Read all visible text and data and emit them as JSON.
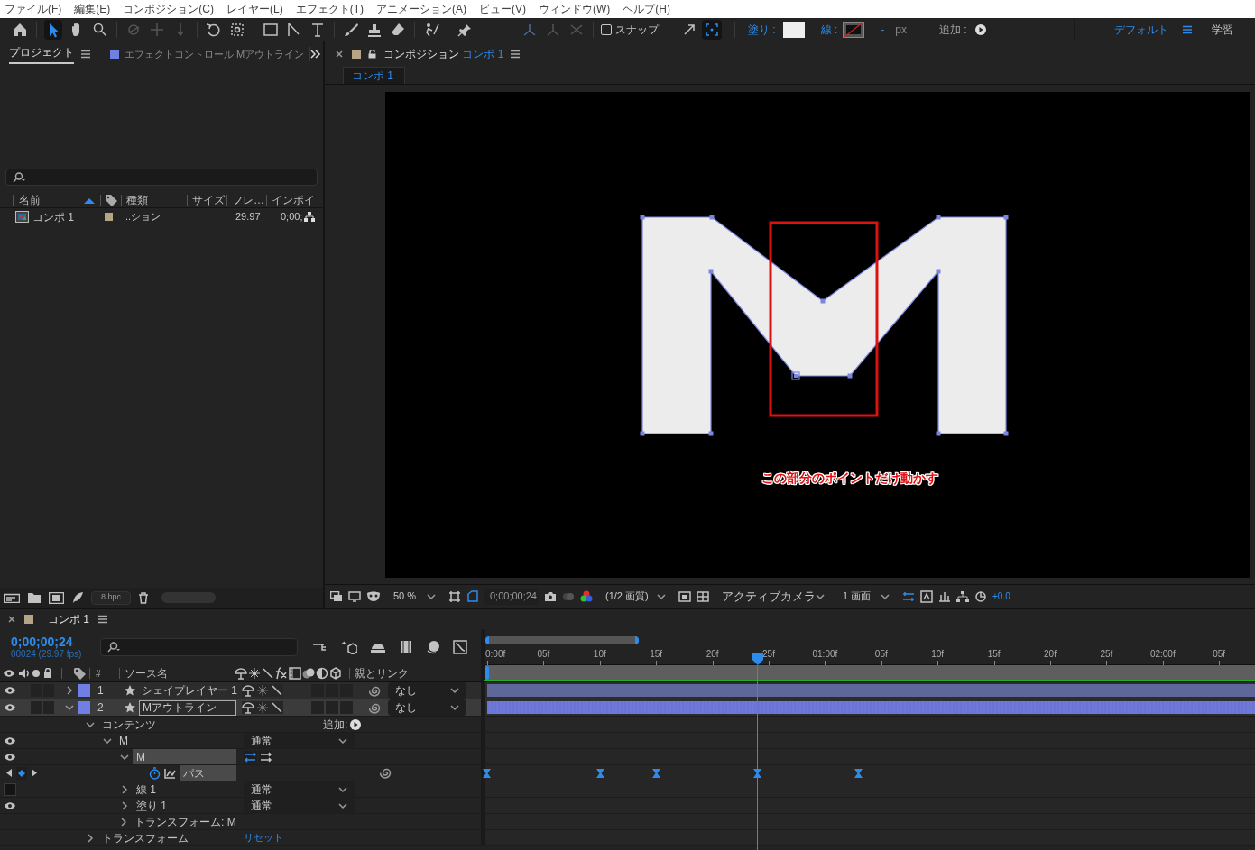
{
  "menu": [
    "ファイル(F)",
    "編集(E)",
    "コンポジション(C)",
    "レイヤー(L)",
    "エフェクト(T)",
    "アニメーション(A)",
    "ビュー(V)",
    "ウィンドウ(W)",
    "ヘルプ(H)"
  ],
  "toolbar": {
    "snap": {
      "label": "スナップ",
      "checked": false
    },
    "fill_label": "塗り :",
    "stroke_label": "線 :",
    "stroke_width": "-",
    "stroke_unit": "px",
    "add_label": "追加 :",
    "workspaces": [
      {
        "label": "デフォルト",
        "selected": true
      },
      {
        "label": "学習",
        "selected": false
      }
    ]
  },
  "project_panel": {
    "tabs": [
      {
        "label": "プロジェクト",
        "selected": true
      },
      {
        "label": "エフェクトコントロール Mアウトライン",
        "selected": false
      }
    ],
    "columns": [
      "名前",
      "種類",
      "サイズ",
      "フレ…",
      "インポイ"
    ],
    "items": [
      {
        "name": "コンポ 1",
        "type": "..ション",
        "frame_rate": "29.97",
        "in_point": "0;00;",
        "color": "#b5a486"
      }
    ],
    "bit_depth": "8 bpc"
  },
  "composition_panel": {
    "tab_title": "コンポジション",
    "tab_comp": "コンポ 1",
    "breadcrumb": "コンポ 1",
    "annotation": "この部分のポイントだけ動かす",
    "footer": {
      "zoom": "50 %",
      "timecode": "0;00;00;24",
      "resolution": "(1/2 画質)",
      "camera": "アクティブカメラ",
      "views": "1 画面",
      "exposure": "+0.0"
    }
  },
  "timeline": {
    "tab": "コンポ 1",
    "timecode": "0;00;00;24",
    "frame_info": "00024 (29.97 fps)",
    "columns": {
      "number": "#",
      "source_name": "ソース名",
      "parent": "親とリンク"
    },
    "ruler": [
      "0:00f",
      "05f",
      "10f",
      "15f",
      "20f",
      "25f",
      "01:00f",
      "05f",
      "10f",
      "15f",
      "20f",
      "25f",
      "02:00f",
      "05f"
    ],
    "layers": [
      {
        "number": "1",
        "name": "シェイプレイヤー 1",
        "color": "#6f7fe3",
        "selected": false,
        "expanded": false,
        "parent": "なし"
      },
      {
        "number": "2",
        "name": "Mアウトライン",
        "color": "#6f7fe3",
        "selected": true,
        "expanded": true,
        "parent": "なし",
        "children": [
          {
            "label": "コンテンツ",
            "kind": "group",
            "expanded": true,
            "selected": false,
            "add_label": "追加:",
            "children": [
              {
                "label": "M",
                "kind": "group",
                "expanded": true,
                "selected": false,
                "visible": true,
                "mode": "通常",
                "children": [
                  {
                    "label": "M",
                    "kind": "path_group",
                    "expanded": true,
                    "selected": true,
                    "visible": true,
                    "children": [
                      {
                        "label": "パス",
                        "kind": "path",
                        "selected": true,
                        "keyframes": [
                          {
                            "level": 0.002
                          },
                          {
                            "level": 0.149
                          },
                          {
                            "level": 0.222
                          },
                          {
                            "level": 0.353
                          },
                          {
                            "level": 0.485
                          }
                        ]
                      }
                    ]
                  },
                  {
                    "label": "線 1",
                    "kind": "group",
                    "expanded": false,
                    "selected": false,
                    "visible": false,
                    "mode": "通常"
                  },
                  {
                    "label": "塗り 1",
                    "kind": "group",
                    "expanded": false,
                    "selected": false,
                    "visible": true,
                    "mode": "通常"
                  },
                  {
                    "label": "トランスフォーム: M",
                    "kind": "group",
                    "expanded": false,
                    "selected": false
                  }
                ]
              }
            ]
          },
          {
            "label": "トランスフォーム",
            "kind": "group",
            "expanded": false,
            "selected": false,
            "reset_label": "リセット"
          }
        ]
      }
    ]
  }
}
